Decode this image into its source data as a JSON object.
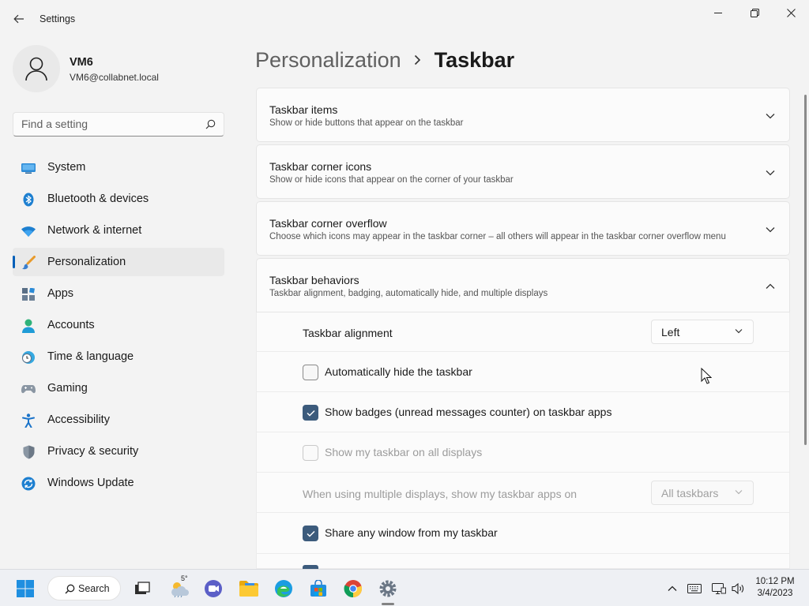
{
  "window": {
    "title": "Settings"
  },
  "user": {
    "name": "VM6",
    "email": "VM6@collabnet.local"
  },
  "search": {
    "placeholder": "Find a setting"
  },
  "nav": {
    "items": [
      {
        "label": "System",
        "icon": "monitor-icon"
      },
      {
        "label": "Bluetooth & devices",
        "icon": "bluetooth-icon"
      },
      {
        "label": "Network & internet",
        "icon": "wifi-icon"
      },
      {
        "label": "Personalization",
        "icon": "brush-icon",
        "active": true
      },
      {
        "label": "Apps",
        "icon": "apps-icon"
      },
      {
        "label": "Accounts",
        "icon": "person-icon"
      },
      {
        "label": "Time & language",
        "icon": "clock-globe-icon"
      },
      {
        "label": "Gaming",
        "icon": "gamepad-icon"
      },
      {
        "label": "Accessibility",
        "icon": "accessibility-icon"
      },
      {
        "label": "Privacy & security",
        "icon": "shield-icon"
      },
      {
        "label": "Windows Update",
        "icon": "update-icon"
      }
    ]
  },
  "breadcrumb": {
    "parent": "Personalization",
    "current": "Taskbar"
  },
  "cards": [
    {
      "title": "Taskbar items",
      "desc": "Show or hide buttons that appear on the taskbar",
      "expanded": false
    },
    {
      "title": "Taskbar corner icons",
      "desc": "Show or hide icons that appear on the corner of your taskbar",
      "expanded": false
    },
    {
      "title": "Taskbar corner overflow",
      "desc": "Choose which icons may appear in the taskbar corner – all others will appear in the taskbar corner overflow menu",
      "expanded": false
    },
    {
      "title": "Taskbar behaviors",
      "desc": "Taskbar alignment, badging, automatically hide, and multiple displays",
      "expanded": true
    }
  ],
  "behaviors": {
    "alignment_label": "Taskbar alignment",
    "alignment_value": "Left",
    "auto_hide": {
      "label": "Automatically hide the taskbar",
      "checked": false
    },
    "badges": {
      "label": "Show badges (unread messages counter) on taskbar apps",
      "checked": true
    },
    "all_displays": {
      "label": "Show my taskbar on all displays",
      "checked": false,
      "disabled": true
    },
    "multi_display_label": "When using multiple displays, show my taskbar apps on",
    "multi_display_value": "All taskbars",
    "share_window": {
      "label": "Share any window from my taskbar",
      "checked": true
    }
  },
  "taskbar": {
    "search_label": "Search",
    "weather_temp": "5°",
    "time": "10:12 PM",
    "date": "3/4/2023",
    "accent": "#005fb8"
  }
}
